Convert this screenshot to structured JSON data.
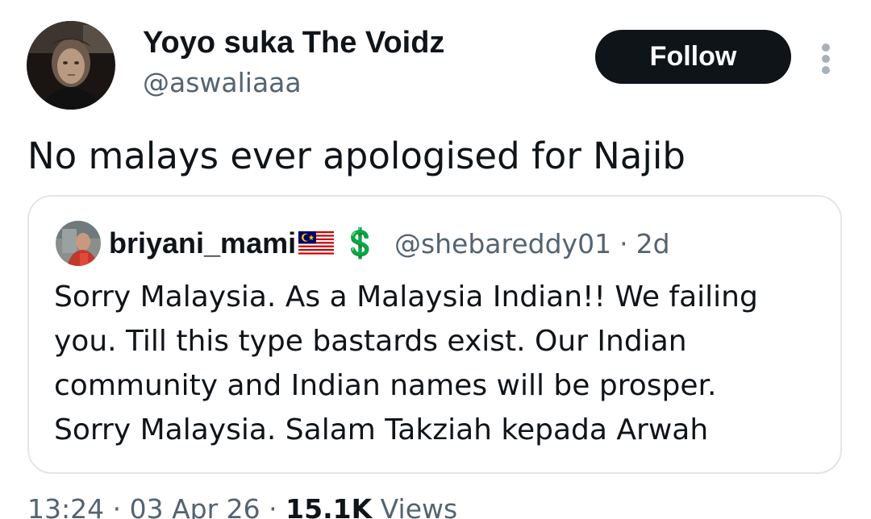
{
  "author": {
    "display_name": "Yoyo suka The Voidz",
    "handle": "@aswaliaaa",
    "avatar_icon": "profile-photo"
  },
  "follow_button": {
    "label": "Follow",
    "background": "#0f1419",
    "text_color": "#ffffff"
  },
  "more_button": {
    "icon": "vertical-ellipsis-icon"
  },
  "tweet": {
    "text": "No malays ever apologised for Najib"
  },
  "quoted_tweet": {
    "display_name": "briyani_mami",
    "flag_icon": "malaysia-flag-icon",
    "badge": "💲",
    "handle": "@shebareddy01",
    "separator": "·",
    "time": "2d",
    "body_lines": [
      "Sorry Malaysia. As a Malaysia Indian!! We failing",
      "you. Till this type bastards exist. Our Indian",
      "community and Indian names will be prosper.",
      "Sorry Malaysia. Salam Takziah kepada Arwah"
    ]
  },
  "meta": {
    "time": "13:24",
    "sep1": "·",
    "date": "03 Apr 26",
    "sep2": "·",
    "views_count": "15.1K",
    "views_label": "Views"
  },
  "colors": {
    "text_primary": "#0f1419",
    "text_secondary": "#536471",
    "border": "#e1e6ea",
    "dollar_green": "#17a34a"
  }
}
